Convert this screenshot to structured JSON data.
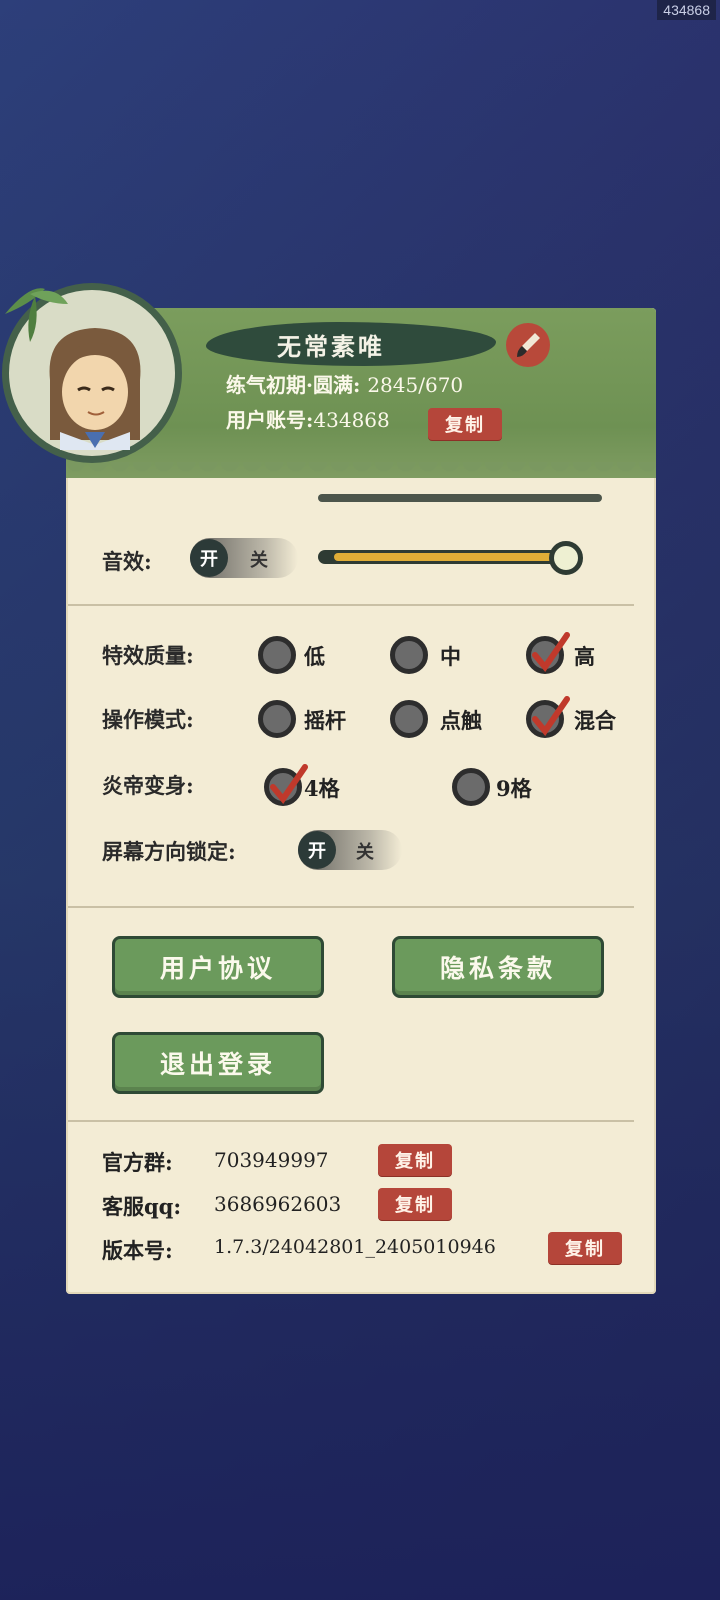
{
  "watermark": "434868",
  "profile": {
    "name": "无常素唯",
    "realm": "练气初期·圆满:",
    "progress": "2845/670",
    "account_label": "用户账号:",
    "account_id": "434868",
    "copy_label": "复制"
  },
  "audio": {
    "sfx_label": "音效:",
    "sfx_toggle_on": "开",
    "sfx_toggle_off": "关",
    "sfx_volume": 1.0
  },
  "settings": {
    "effect_quality_label": "特效质量:",
    "effect_quality_options": [
      "低",
      "中",
      "高"
    ],
    "effect_quality_selected": "高",
    "control_mode_label": "操作模式:",
    "control_mode_options": [
      "摇杆",
      "点触",
      "混合"
    ],
    "control_mode_selected": "混合",
    "transform_label": "炎帝变身:",
    "transform_options": [
      "4格",
      "9格"
    ],
    "transform_selected": "4格",
    "orientation_lock_label": "屏幕方向锁定:",
    "orientation_toggle_on": "开",
    "orientation_toggle_off": "关"
  },
  "buttons": {
    "user_agreement": "用户协议",
    "privacy_policy": "隐私条款",
    "logout": "退出登录"
  },
  "info": {
    "group_label": "官方群:",
    "group_value": "703949997",
    "qq_label": "客服qq:",
    "qq_value": "3686962603",
    "version_label": "版本号:",
    "version_value": "1.7.3/24042801_2405010946",
    "copy_label": "复制"
  },
  "colors": {
    "panel": "#f3ecd5",
    "header": "#6e9153",
    "accent_red": "#b5463a",
    "button_green": "#6b9a5c",
    "slider_fill": "#e0ad37"
  }
}
